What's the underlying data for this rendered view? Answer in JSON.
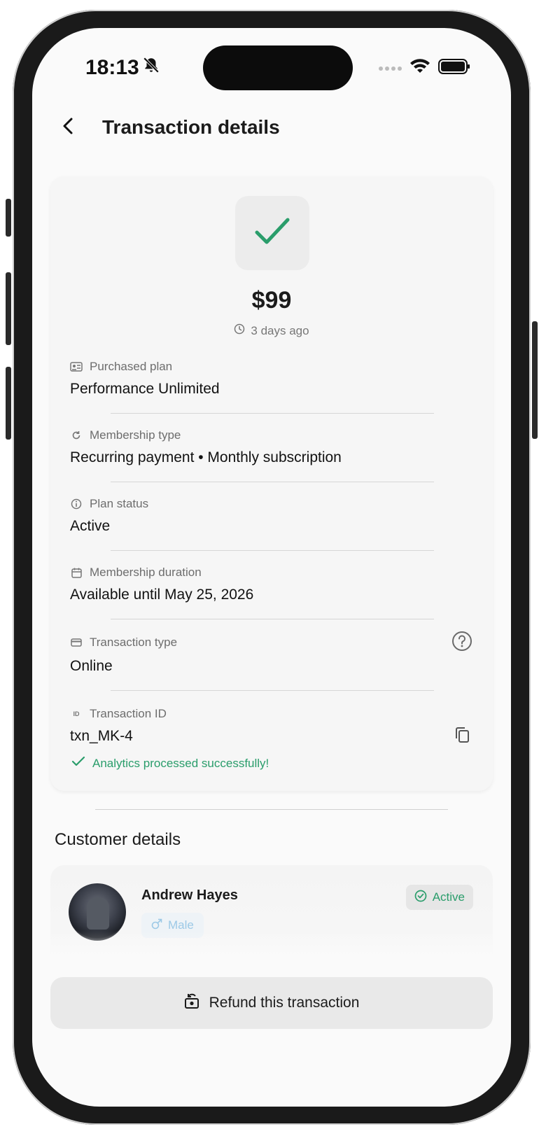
{
  "status_bar": {
    "time": "18:13",
    "icons": [
      "bell-slash-icon",
      "signal-dots-icon",
      "wifi-icon",
      "battery-icon"
    ]
  },
  "header": {
    "back_icon": "chevron-left-icon",
    "title": "Transaction details"
  },
  "summary": {
    "status_icon": "checkmark-icon",
    "amount": "$99",
    "time_ago": "3 days ago"
  },
  "details": [
    {
      "icon": "id-card-icon",
      "label": "Purchased plan",
      "value": "Performance Unlimited"
    },
    {
      "icon": "refresh-icon",
      "label": "Membership type",
      "value": "Recurring payment • Monthly subscription"
    },
    {
      "icon": "info-icon",
      "label": "Plan status",
      "value": "Active"
    },
    {
      "icon": "calendar-icon",
      "label": "Membership duration",
      "value": "Available until May 25, 2026"
    },
    {
      "icon": "credit-card-icon",
      "label": "Transaction type",
      "value": "Online"
    },
    {
      "icon": "id-badge-icon",
      "label": "Transaction ID",
      "value": "txn_MK-4"
    }
  ],
  "id_badge_text": "ID",
  "success_message": "Analytics processed successfully!",
  "customer_section": {
    "title": "Customer details",
    "name": "Andrew Hayes",
    "gender": "Male",
    "status": "Active"
  },
  "refund_button": "Refund this transaction",
  "colors": {
    "accent_green": "#2a9d6b",
    "gender_blue": "#9cc9e6",
    "card_bg": "#f6f6f6"
  }
}
